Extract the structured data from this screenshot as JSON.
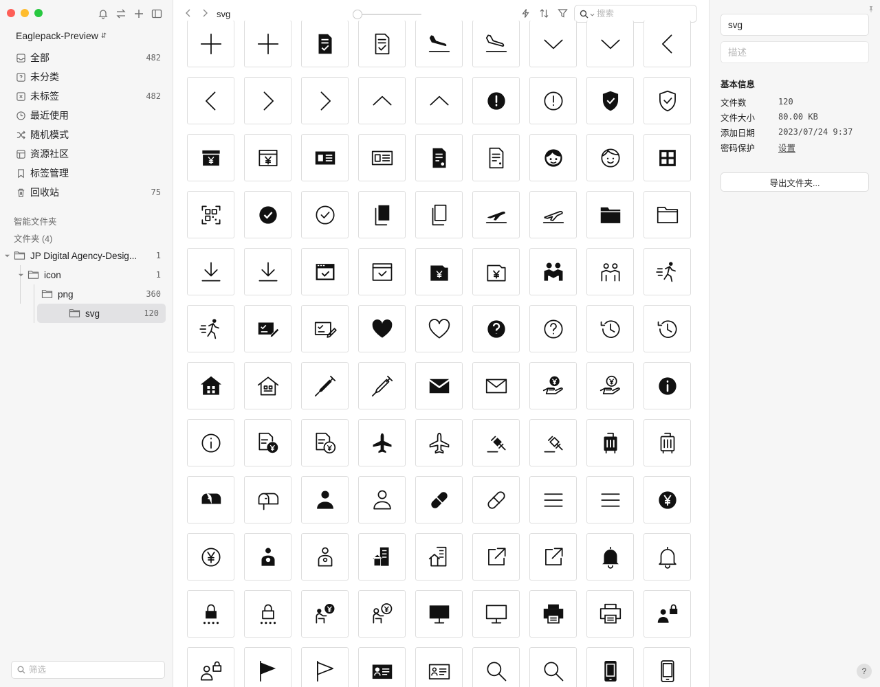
{
  "window": {
    "buttons": {
      "close": "#fe5f57",
      "minimize": "#febc2e",
      "zoom": "#28c840"
    }
  },
  "sidebar": {
    "tool_icons": [
      "bell-icon",
      "swap-icon",
      "plus-icon",
      "sidebar-toggle-icon"
    ],
    "library_name": "Eaglepack-Preview",
    "nav": [
      {
        "id": "all",
        "label": "全部",
        "count": "482",
        "icon": "inbox-icon"
      },
      {
        "id": "uncategorized",
        "label": "未分类",
        "count": "",
        "icon": "question-box-icon"
      },
      {
        "id": "untagged",
        "label": "未标签",
        "count": "482",
        "icon": "tag-box-icon"
      },
      {
        "id": "recent",
        "label": "最近使用",
        "count": "",
        "icon": "clock-icon"
      },
      {
        "id": "random",
        "label": "随机模式",
        "count": "",
        "icon": "shuffle-icon"
      },
      {
        "id": "community",
        "label": "资源社区",
        "count": "",
        "icon": "community-icon"
      },
      {
        "id": "tags",
        "label": "标签管理",
        "count": "",
        "icon": "bookmark-icon"
      },
      {
        "id": "trash",
        "label": "回收站",
        "count": "75",
        "icon": "trash-icon"
      }
    ],
    "smart_folders_title": "智能文件夹",
    "folders_title": "文件夹 (4)",
    "tree": [
      {
        "label": "JP Digital Agency-Desig...",
        "count": "1"
      },
      {
        "label": "icon",
        "count": "1"
      },
      {
        "label": "png",
        "count": "360"
      },
      {
        "label": "svg",
        "count": "120"
      }
    ],
    "filter_placeholder": "筛选"
  },
  "toolbar": {
    "title": "svg",
    "search_placeholder": "搜索",
    "tools": [
      "bolt-icon",
      "sort-icon",
      "filter-icon"
    ]
  },
  "grid": {
    "columns": 9,
    "icons": [
      "add",
      "add-outline",
      "document-check",
      "document-check-outline",
      "plane-landing",
      "plane-landing-outline",
      "chevron-down",
      "chevron-down-outline",
      "chevron-left",
      "chevron-left-outline",
      "chevron-right",
      "chevron-right-outline",
      "chevron-up",
      "chevron-up-outline",
      "exclamation-circle",
      "exclamation-circle-outline",
      "shield-check",
      "shield-check-outline",
      "yen-box",
      "yen-box-outline",
      "id-card",
      "id-card-outline",
      "document-pin",
      "document-pin-outline",
      "face",
      "face-outline",
      "grid-apps",
      "qr-scan",
      "check-circle",
      "check-circle-outline",
      "copy",
      "copy-outline",
      "plane-takeoff",
      "plane-takeoff-outline",
      "folder",
      "folder-outline",
      "download",
      "download-outline",
      "window-check",
      "window-check-outline",
      "wallet-yen",
      "wallet-yen-outline",
      "people",
      "people-outline",
      "runner",
      "runner-outline",
      "form-pen",
      "form-pen-outline",
      "heart",
      "heart-outline",
      "question-circle",
      "question-circle-outline",
      "history",
      "history-outline",
      "house",
      "house-outline",
      "syringe",
      "syringe-outline",
      "mail",
      "mail-outline",
      "hand-yen",
      "hand-yen-outline",
      "info-circle",
      "info-circle-outline",
      "document-yen",
      "document-yen-outline",
      "airplane",
      "airplane-outline",
      "gavel",
      "gavel-outline",
      "luggage",
      "luggage-outline",
      "mailbox",
      "mailbox-outline",
      "person",
      "person-outline",
      "pill",
      "pill-outline",
      "menu",
      "menu-outline",
      "yen-circle",
      "yen-circle-outline",
      "person-badge",
      "person-badge-outline",
      "home-doc",
      "home-doc-outline",
      "external-link",
      "external-link-outline",
      "bell",
      "bell-outline",
      "lock-dots",
      "lock-dots-outline",
      "worker-yen",
      "worker-yen-outline",
      "monitor",
      "monitor-outline",
      "printer",
      "printer-outline",
      "person-lock",
      "person-lock-outline",
      "flag",
      "flag-outline",
      "id-badge",
      "id-badge-outline",
      "magnifier",
      "magnifier-outline",
      "smartphone",
      "smartphone-outline"
    ]
  },
  "inspector": {
    "name": "svg",
    "description_placeholder": "描述",
    "info_heading": "基本信息",
    "rows": [
      {
        "label": "文件数",
        "value": "120"
      },
      {
        "label": "文件大小",
        "value": "80.00 KB"
      },
      {
        "label": "添加日期",
        "value": "2023/07/24 9:37"
      },
      {
        "label": "密码保护",
        "value": "设置"
      }
    ],
    "export_label": "导出文件夹...",
    "help_label": "?"
  }
}
